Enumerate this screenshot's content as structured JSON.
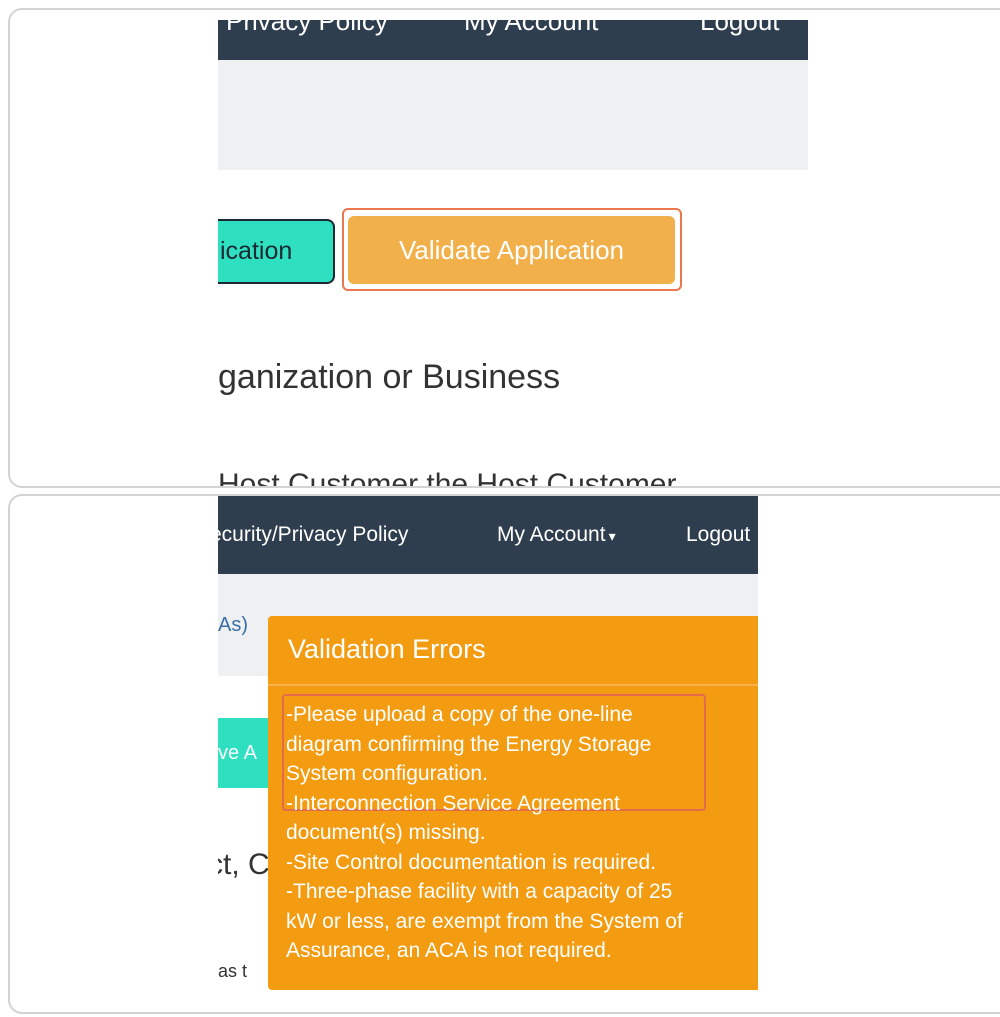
{
  "top_view": {
    "nav": {
      "privacy_label": "Privacy Policy",
      "account_label": "My Account",
      "logout_label": "Logout"
    },
    "save_button_label": "ication",
    "validate_button_label": "Validate Application",
    "section_heading": "ganization or Business",
    "cut_text": "Host Customer the Host Customer"
  },
  "bottom_view": {
    "nav": {
      "privacy_label": "ecurity/Privacy Policy",
      "account_label": "My Account",
      "account_caret": "▾",
      "logout_label": "Logout"
    },
    "link_fragment": "As)",
    "button_fragment": "ve A",
    "heading_fragment": "ct, C",
    "text_fragment": "as t",
    "validation_popover": {
      "title": "Validation Errors",
      "errors": [
        "-Please upload a copy of the one-line",
        "diagram confirming the Energy Storage",
        "System configuration.",
        "-Interconnection Service Agreement",
        "document(s) missing.",
        "-Site Control documentation is required.",
        "-Three-phase facility with a capacity of 25",
        "kW or less, are exempt from the System of",
        "Assurance, an ACA is not required."
      ]
    }
  },
  "colors": {
    "navbar": "#2f3e4e",
    "validate_button": "#f2b04a",
    "save_button": "#2ee0c0",
    "popover": "#f39c12",
    "highlight_border": "#e9784f"
  }
}
